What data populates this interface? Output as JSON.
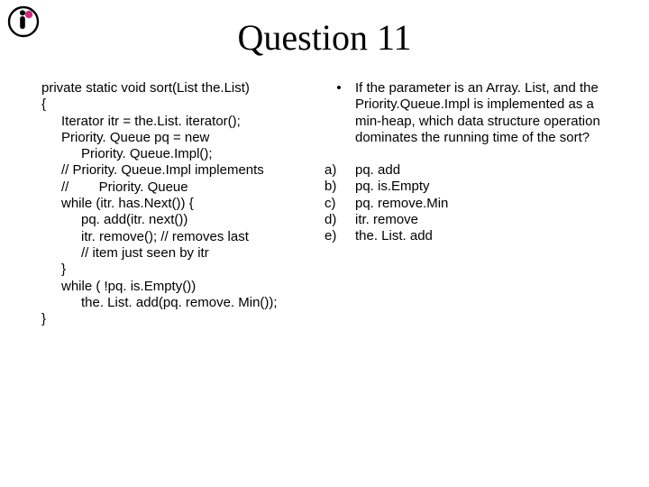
{
  "title": "Question 11",
  "code": {
    "l1": "private static void sort(List the.List)",
    "l2": "{",
    "l3": "Iterator itr = the.List. iterator();",
    "l4": "Priority. Queue pq = new",
    "l5": "Priority. Queue.Impl();",
    "l6": "// Priority. Queue.Impl implements",
    "l7": "//        Priority. Queue",
    "l8": "while (itr. has.Next()) {",
    "l9": "pq. add(itr. next())",
    "l10": "itr. remove(); // removes last",
    "l11": "// item just seen by itr",
    "l12": "}",
    "l13": "while ( !pq. is.Empty())",
    "l14": "the. List. add(pq. remove. Min());",
    "l15": "}"
  },
  "question": {
    "bullet": "•",
    "text": "If the parameter is an Array. List, and the Priority.Queue.Impl is implemented as a min-heap, which data structure operation dominates the running time of the sort?"
  },
  "options": [
    {
      "marker": "a)",
      "text": "pq. add"
    },
    {
      "marker": "b)",
      "text": "pq. is.Empty"
    },
    {
      "marker": "c)",
      "text": "pq. remove.Min"
    },
    {
      "marker": "d)",
      "text": "itr. remove"
    },
    {
      "marker": "e)",
      "text": "the. List. add"
    }
  ]
}
